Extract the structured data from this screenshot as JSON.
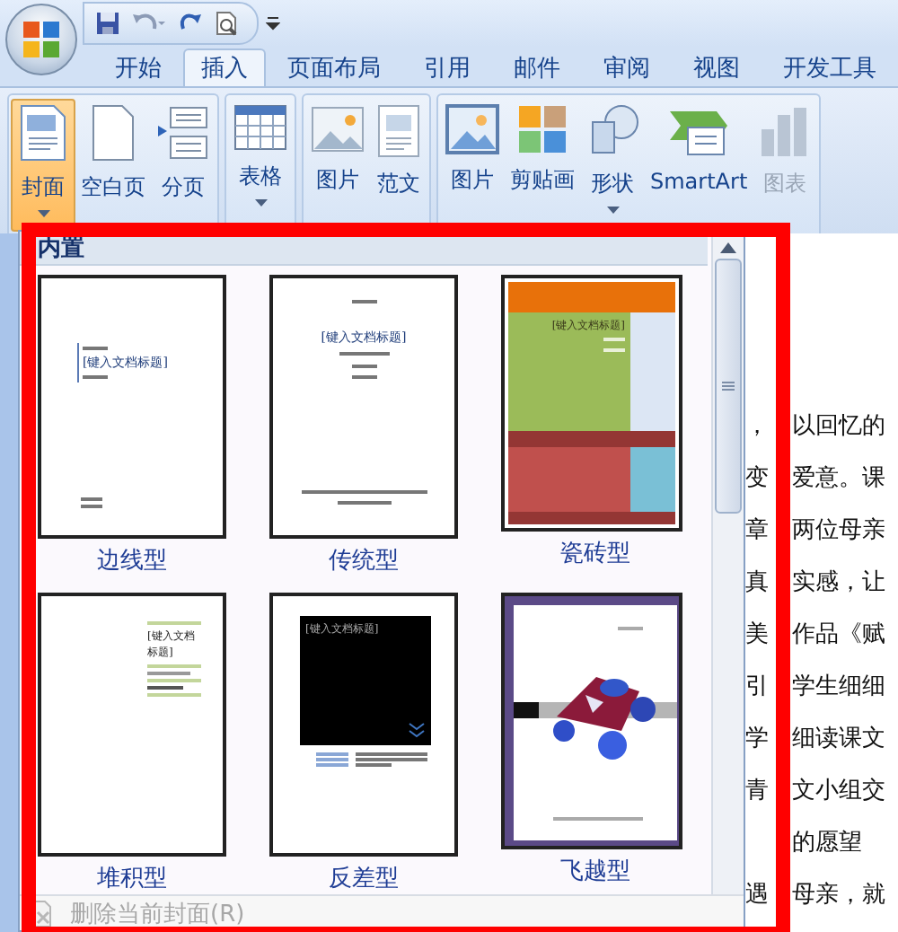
{
  "tabs": [
    {
      "label": "开始",
      "selected": false
    },
    {
      "label": "插入",
      "selected": true
    },
    {
      "label": "页面布局",
      "selected": false
    },
    {
      "label": "引用",
      "selected": false
    },
    {
      "label": "邮件",
      "selected": false
    },
    {
      "label": "审阅",
      "selected": false
    },
    {
      "label": "视图",
      "selected": false
    },
    {
      "label": "开发工具",
      "selected": false
    }
  ],
  "ribbon_groups": [
    {
      "buttons": [
        {
          "label": "封面",
          "dropdown": true,
          "active": true,
          "disabled": false
        },
        {
          "label": "空白页",
          "dropdown": false,
          "active": false,
          "disabled": false
        },
        {
          "label": "分页",
          "dropdown": false,
          "active": false,
          "disabled": false
        }
      ]
    },
    {
      "buttons": [
        {
          "label": "表格",
          "dropdown": true,
          "active": false,
          "disabled": false
        }
      ]
    },
    {
      "buttons": [
        {
          "label": "图片",
          "dropdown": false,
          "active": false,
          "disabled": false
        },
        {
          "label": "范文",
          "dropdown": false,
          "active": false,
          "disabled": false
        }
      ]
    },
    {
      "buttons": [
        {
          "label": "图片",
          "dropdown": false,
          "active": false,
          "disabled": false
        },
        {
          "label": "剪贴画",
          "dropdown": false,
          "active": false,
          "disabled": false
        },
        {
          "label": "形状",
          "dropdown": true,
          "active": false,
          "disabled": false
        },
        {
          "label": "SmartArt",
          "dropdown": false,
          "active": false,
          "disabled": false
        },
        {
          "label": "图表",
          "dropdown": false,
          "active": false,
          "disabled": true
        }
      ]
    }
  ],
  "gallery": {
    "heading": "内置",
    "items": [
      {
        "name": "边线型",
        "kind": "sideline",
        "preview_title": "[键入文档标题]"
      },
      {
        "name": "传统型",
        "kind": "traditional",
        "preview_title": "[键入文档标题]"
      },
      {
        "name": "瓷砖型",
        "kind": "tile",
        "preview_title": "[键入文档标题]"
      },
      {
        "name": "堆积型",
        "kind": "stack",
        "preview_title": "[键入文档标题]"
      },
      {
        "name": "反差型",
        "kind": "contrast",
        "preview_title": "[键入文档标题]"
      },
      {
        "name": "飞越型",
        "kind": "motion"
      }
    ],
    "footer": {
      "label": "删除当前封面(R)",
      "disabled": true
    }
  },
  "document": {
    "lines": [
      {
        "lead": "，",
        "rest": "以回忆的"
      },
      {
        "lead": "变",
        "rest": "爱意。课"
      },
      {
        "lead": "章",
        "rest": "两位母亲"
      },
      {
        "lead": "真",
        "rest": "实感，让"
      },
      {
        "lead": "美",
        "rest": "作品《赋"
      },
      {
        "lead": "引",
        "rest": "学生细细"
      },
      {
        "lead": "学",
        "rest": "细读课文"
      },
      {
        "lead": "青",
        "rest": "文小组交"
      },
      {
        "rest": "的愿望"
      },
      {
        "lead": "遇",
        "rest": "母亲，就"
      }
    ]
  }
}
